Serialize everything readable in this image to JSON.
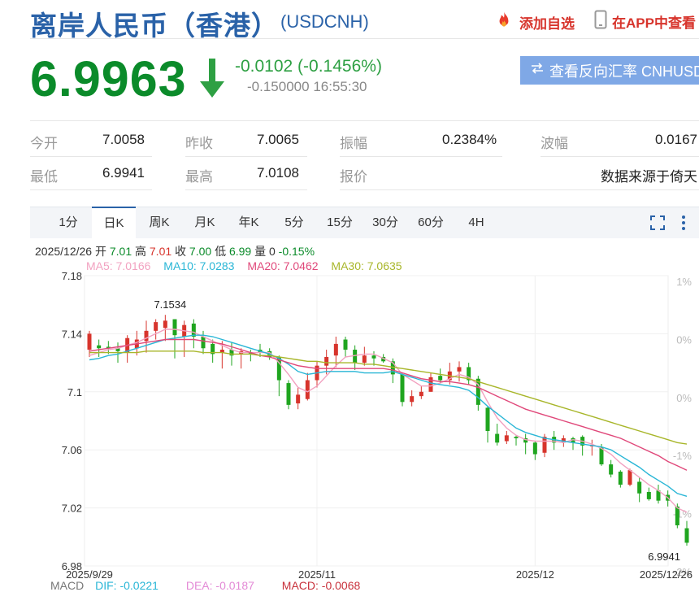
{
  "header": {
    "title": "离岸人民币（香港）",
    "code": "(USDCNH)",
    "add_fav": "添加自选",
    "app_view": "在APP中查看",
    "colors": {
      "title": "#2a62a8",
      "action": "#d7342c",
      "down": "#0b8b2a"
    }
  },
  "quote": {
    "price": "6.9963",
    "change": "-0.0102 (-0.1456%)",
    "change_abs": "-0.150000",
    "time": "16:55:30",
    "reverse_rate_button": "查看反向汇率 CNHUSD"
  },
  "stats": [
    {
      "label": "今开",
      "value": "7.0058"
    },
    {
      "label": "昨收",
      "value": "7.0065"
    },
    {
      "label": "振幅",
      "value": "0.2384%"
    },
    {
      "label": "波幅",
      "value": "0.0167"
    },
    {
      "label": "最低",
      "value": "6.9941"
    },
    {
      "label": "最高",
      "value": "7.0108"
    },
    {
      "label": "报价",
      "value": ""
    },
    {
      "label": "",
      "value": "数据来源于倚天"
    }
  ],
  "periods": [
    "1分",
    "日K",
    "周K",
    "月K",
    "年K",
    "5分",
    "15分",
    "30分",
    "60分",
    "4H"
  ],
  "active_period": "日K",
  "ohlc_bar": {
    "date": "2025/12/26",
    "open_label": "开",
    "open": "7.01",
    "high_label": "高",
    "high": "7.01",
    "close_label": "收",
    "close": "7.00",
    "low_label": "低",
    "low": "6.99",
    "vol_label": "量",
    "vol": "0",
    "pct": "-0.15%"
  },
  "ma_legend": [
    {
      "text": "MA5: 7.0166",
      "color": "#f2a1c0"
    },
    {
      "text": "MA10: 7.0283",
      "color": "#29b6d6"
    },
    {
      "text": "MA20: 7.0462",
      "color": "#e0487a"
    },
    {
      "text": "MA30: 7.0635",
      "color": "#a8b62a"
    }
  ],
  "macd_legend": [
    {
      "text": "MACD",
      "color": "#777777"
    },
    {
      "text": "DIF: -0.0221",
      "color": "#29b6d6"
    },
    {
      "text": "DEA: -0.0187",
      "color": "#e38ad6"
    },
    {
      "text": "MACD: -0.0068",
      "color": "#c8323c"
    }
  ],
  "chart_data": {
    "type": "candlestick",
    "ylim": [
      6.98,
      7.18
    ],
    "y_ticks": [
      "7.18",
      "7.14",
      "7.1",
      "7.06",
      "7.02",
      "6.98"
    ],
    "right_ticks": [
      "1%",
      "0%",
      "0%",
      "-1%",
      "-1%",
      "-2%"
    ],
    "x_labels": [
      "2025/9/29",
      "2025/11",
      "2025/12",
      "2025/12/26"
    ],
    "x_label_index": [
      0,
      24,
      47,
      63
    ],
    "max_label": "7.1534",
    "min_label": "6.9941",
    "colors": {
      "up": "#d7342c",
      "down": "#1fa51f",
      "ma5": "#f2a1c0",
      "ma10": "#29b6d6",
      "ma20": "#e0487a",
      "ma30": "#a8b62a"
    },
    "candles": [
      {
        "o": 7.129,
        "c": 7.14,
        "h": 7.142,
        "l": 7.124
      },
      {
        "o": 7.132,
        "c": 7.13,
        "h": 7.136,
        "l": 7.124
      },
      {
        "o": 7.131,
        "c": 7.13,
        "h": 7.135,
        "l": 7.126
      },
      {
        "o": 7.13,
        "c": 7.128,
        "h": 7.134,
        "l": 7.12
      },
      {
        "o": 7.127,
        "c": 7.137,
        "h": 7.139,
        "l": 7.12
      },
      {
        "o": 7.13,
        "c": 7.136,
        "h": 7.142,
        "l": 7.125
      },
      {
        "o": 7.135,
        "c": 7.142,
        "h": 7.149,
        "l": 7.127
      },
      {
        "o": 7.142,
        "c": 7.148,
        "h": 7.15,
        "l": 7.136
      },
      {
        "o": 7.144,
        "c": 7.149,
        "h": 7.153,
        "l": 7.135
      },
      {
        "o": 7.15,
        "c": 7.139,
        "h": 7.15,
        "l": 7.123
      },
      {
        "o": 7.138,
        "c": 7.146,
        "h": 7.149,
        "l": 7.124
      },
      {
        "o": 7.147,
        "c": 7.138,
        "h": 7.15,
        "l": 7.13
      },
      {
        "o": 7.138,
        "c": 7.13,
        "h": 7.142,
        "l": 7.126
      },
      {
        "o": 7.133,
        "c": 7.126,
        "h": 7.136,
        "l": 7.12
      },
      {
        "o": 7.127,
        "c": 7.129,
        "h": 7.135,
        "l": 7.116
      },
      {
        "o": 7.129,
        "c": 7.125,
        "h": 7.134,
        "l": 7.118
      },
      {
        "o": 7.126,
        "c": 7.128,
        "h": 7.13,
        "l": 7.116
      },
      {
        "o": 7.127,
        "c": 7.126,
        "h": 7.129,
        "l": 7.121
      },
      {
        "o": 7.129,
        "c": 7.127,
        "h": 7.133,
        "l": 7.124
      },
      {
        "o": 7.128,
        "c": 7.124,
        "h": 7.13,
        "l": 7.122
      },
      {
        "o": 7.124,
        "c": 7.108,
        "h": 7.125,
        "l": 7.097
      },
      {
        "o": 7.106,
        "c": 7.091,
        "h": 7.108,
        "l": 7.088
      },
      {
        "o": 7.092,
        "c": 7.098,
        "h": 7.103,
        "l": 7.088
      },
      {
        "o": 7.095,
        "c": 7.108,
        "h": 7.113,
        "l": 7.094
      },
      {
        "o": 7.108,
        "c": 7.118,
        "h": 7.121,
        "l": 7.103
      },
      {
        "o": 7.118,
        "c": 7.124,
        "h": 7.129,
        "l": 7.112
      },
      {
        "o": 7.125,
        "c": 7.133,
        "h": 7.138,
        "l": 7.117
      },
      {
        "o": 7.136,
        "c": 7.129,
        "h": 7.138,
        "l": 7.124
      },
      {
        "o": 7.129,
        "c": 7.12,
        "h": 7.132,
        "l": 7.115
      },
      {
        "o": 7.12,
        "c": 7.125,
        "h": 7.131,
        "l": 7.118
      },
      {
        "o": 7.125,
        "c": 7.123,
        "h": 7.128,
        "l": 7.118
      },
      {
        "o": 7.124,
        "c": 7.121,
        "h": 7.126,
        "l": 7.12
      },
      {
        "o": 7.121,
        "c": 7.112,
        "h": 7.123,
        "l": 7.106
      },
      {
        "o": 7.112,
        "c": 7.093,
        "h": 7.113,
        "l": 7.09
      },
      {
        "o": 7.093,
        "c": 7.097,
        "h": 7.101,
        "l": 7.09
      },
      {
        "o": 7.097,
        "c": 7.1,
        "h": 7.104,
        "l": 7.095
      },
      {
        "o": 7.1,
        "c": 7.11,
        "h": 7.113,
        "l": 7.1
      },
      {
        "o": 7.111,
        "c": 7.108,
        "h": 7.116,
        "l": 7.106
      },
      {
        "o": 7.108,
        "c": 7.114,
        "h": 7.12,
        "l": 7.105
      },
      {
        "o": 7.114,
        "c": 7.117,
        "h": 7.121,
        "l": 7.107
      },
      {
        "o": 7.117,
        "c": 7.108,
        "h": 7.12,
        "l": 7.105
      },
      {
        "o": 7.109,
        "c": 7.091,
        "h": 7.111,
        "l": 7.087
      },
      {
        "o": 7.089,
        "c": 7.073,
        "h": 7.09,
        "l": 7.065
      },
      {
        "o": 7.071,
        "c": 7.065,
        "h": 7.078,
        "l": 7.063
      },
      {
        "o": 7.066,
        "c": 7.07,
        "h": 7.073,
        "l": 7.064
      },
      {
        "o": 7.069,
        "c": 7.068,
        "h": 7.07,
        "l": 7.063
      },
      {
        "o": 7.068,
        "c": 7.065,
        "h": 7.071,
        "l": 7.057
      },
      {
        "o": 7.065,
        "c": 7.057,
        "h": 7.066,
        "l": 7.053
      },
      {
        "o": 7.058,
        "c": 7.069,
        "h": 7.071,
        "l": 7.055
      },
      {
        "o": 7.069,
        "c": 7.065,
        "h": 7.073,
        "l": 7.06
      },
      {
        "o": 7.065,
        "c": 7.068,
        "h": 7.07,
        "l": 7.062
      },
      {
        "o": 7.068,
        "c": 7.065,
        "h": 7.069,
        "l": 7.06
      },
      {
        "o": 7.069,
        "c": 7.063,
        "h": 7.07,
        "l": 7.056
      },
      {
        "o": 7.063,
        "c": 7.063,
        "h": 7.067,
        "l": 7.056
      },
      {
        "o": 7.062,
        "c": 7.05,
        "h": 7.064,
        "l": 7.049
      },
      {
        "o": 7.05,
        "c": 7.043,
        "h": 7.053,
        "l": 7.041
      },
      {
        "o": 7.045,
        "c": 7.036,
        "h": 7.046,
        "l": 7.034
      },
      {
        "o": 7.036,
        "c": 7.046,
        "h": 7.047,
        "l": 7.035
      },
      {
        "o": 7.038,
        "c": 7.03,
        "h": 7.041,
        "l": 7.024
      },
      {
        "o": 7.031,
        "c": 7.026,
        "h": 7.034,
        "l": 7.025
      },
      {
        "o": 7.032,
        "c": 7.025,
        "h": 7.036,
        "l": 7.023
      },
      {
        "o": 7.029,
        "c": 7.025,
        "h": 7.032,
        "l": 7.021
      },
      {
        "o": 7.021,
        "c": 7.008,
        "h": 7.023,
        "l": 7.006
      },
      {
        "o": 7.006,
        "c": 6.996,
        "h": 7.011,
        "l": 6.994
      }
    ],
    "series": [
      {
        "name": "MA5",
        "values": [
          7.125,
          7.127,
          7.129,
          7.13,
          7.132,
          7.134,
          7.137,
          7.14,
          7.143,
          7.143,
          7.142,
          7.141,
          7.138,
          7.135,
          7.132,
          7.129,
          7.127,
          7.127,
          7.127,
          7.127,
          7.12,
          7.112,
          7.103,
          7.1,
          7.104,
          7.111,
          7.118,
          7.124,
          7.125,
          7.126,
          7.126,
          7.123,
          7.12,
          7.112,
          7.108,
          7.104,
          7.104,
          7.106,
          7.109,
          7.112,
          7.11,
          7.105,
          7.093,
          7.082,
          7.075,
          7.07,
          7.067,
          7.066,
          7.066,
          7.066,
          7.065,
          7.067,
          7.066,
          7.064,
          7.061,
          7.057,
          7.051,
          7.046,
          7.041,
          7.036,
          7.032,
          7.027,
          7.02,
          7.017
        ]
      },
      {
        "name": "MA10",
        "values": [
          7.122,
          7.123,
          7.125,
          7.126,
          7.128,
          7.13,
          7.132,
          7.134,
          7.136,
          7.137,
          7.138,
          7.139,
          7.139,
          7.138,
          7.136,
          7.134,
          7.132,
          7.13,
          7.128,
          7.126,
          7.123,
          7.119,
          7.114,
          7.112,
          7.113,
          7.114,
          7.114,
          7.114,
          7.114,
          7.113,
          7.113,
          7.113,
          7.114,
          7.112,
          7.11,
          7.108,
          7.106,
          7.105,
          7.104,
          7.103,
          7.101,
          7.096,
          7.09,
          7.085,
          7.08,
          7.075,
          7.072,
          7.07,
          7.068,
          7.067,
          7.066,
          7.065,
          7.064,
          7.063,
          7.062,
          7.06,
          7.056,
          7.052,
          7.048,
          7.043,
          7.039,
          7.035,
          7.03,
          7.028
        ]
      },
      {
        "name": "MA20",
        "values": [
          7.128,
          7.129,
          7.13,
          7.131,
          7.132,
          7.133,
          7.134,
          7.135,
          7.136,
          7.136,
          7.136,
          7.136,
          7.135,
          7.134,
          7.133,
          7.131,
          7.129,
          7.127,
          7.125,
          7.124,
          7.122,
          7.12,
          7.118,
          7.117,
          7.116,
          7.116,
          7.116,
          7.116,
          7.116,
          7.116,
          7.116,
          7.116,
          7.115,
          7.113,
          7.111,
          7.109,
          7.108,
          7.107,
          7.107,
          7.106,
          7.105,
          7.103,
          7.1,
          7.097,
          7.094,
          7.091,
          7.088,
          7.086,
          7.084,
          7.082,
          7.08,
          7.078,
          7.076,
          7.074,
          7.072,
          7.07,
          7.068,
          7.065,
          7.062,
          7.059,
          7.056,
          7.052,
          7.049,
          7.046
        ]
      },
      {
        "name": "MA30",
        "values": [
          7.127,
          7.127,
          7.127,
          7.127,
          7.127,
          7.127,
          7.128,
          7.128,
          7.128,
          7.128,
          7.128,
          7.128,
          7.127,
          7.127,
          7.127,
          7.126,
          7.126,
          7.126,
          7.125,
          7.125,
          7.124,
          7.123,
          7.122,
          7.121,
          7.121,
          7.12,
          7.12,
          7.12,
          7.12,
          7.119,
          7.119,
          7.118,
          7.117,
          7.116,
          7.115,
          7.114,
          7.113,
          7.112,
          7.111,
          7.11,
          7.109,
          7.107,
          7.105,
          7.103,
          7.101,
          7.099,
          7.097,
          7.095,
          7.093,
          7.091,
          7.089,
          7.087,
          7.085,
          7.083,
          7.081,
          7.079,
          7.077,
          7.075,
          7.073,
          7.071,
          7.069,
          7.067,
          7.065,
          7.064
        ]
      }
    ]
  }
}
